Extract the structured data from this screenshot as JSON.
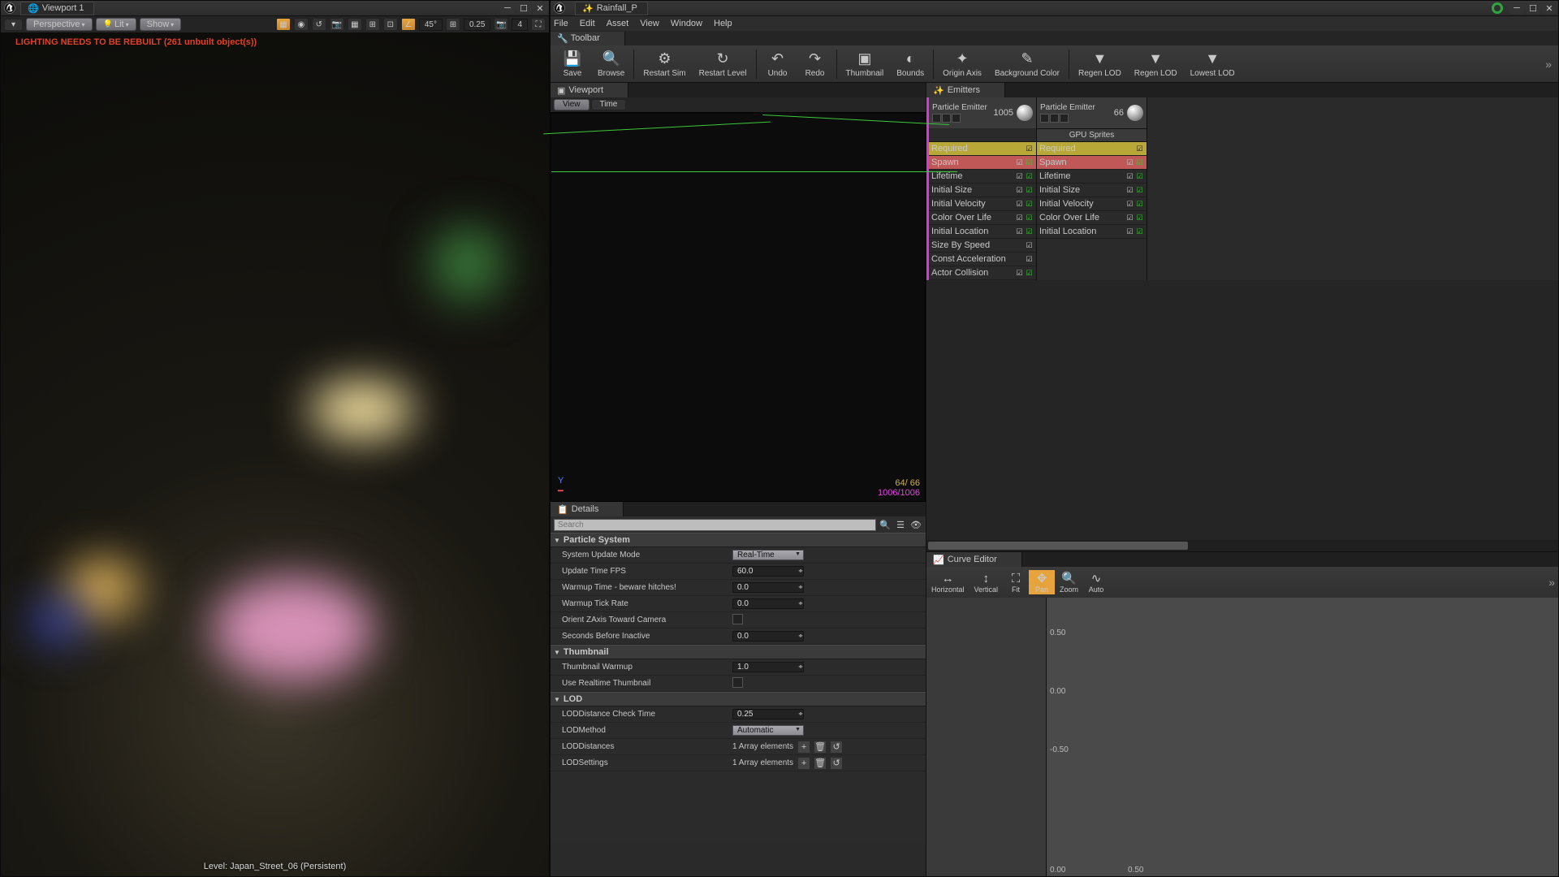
{
  "leftWindow": {
    "tabTitle": "Viewport 1",
    "viewportControls": {
      "perspective": "Perspective",
      "lit": "Lit",
      "show": "Show",
      "angleSnap": "45°",
      "gridSnap": "0.25",
      "scaleSnap": "4"
    },
    "warning": "LIGHTING NEEDS TO BE REBUILT (261 unbuilt object(s))",
    "levelLabel": "Level: Japan_Street_06 (Persistent)"
  },
  "rightWindow": {
    "tabTitle": "Rainfall_P",
    "menus": [
      "File",
      "Edit",
      "Asset",
      "View",
      "Window",
      "Help"
    ],
    "toolbarTab": "Toolbar",
    "toolbar": [
      {
        "label": "Save",
        "icon": "💾"
      },
      {
        "label": "Browse",
        "icon": "🔍"
      },
      {
        "label": "Restart Sim",
        "icon": "⚙"
      },
      {
        "label": "Restart Level",
        "icon": "↻"
      },
      {
        "label": "Undo",
        "icon": "↶"
      },
      {
        "label": "Redo",
        "icon": "↷"
      },
      {
        "label": "Thumbnail",
        "icon": "▣"
      },
      {
        "label": "Bounds",
        "icon": "◐"
      },
      {
        "label": "Origin Axis",
        "icon": "✦"
      },
      {
        "label": "Background Color",
        "icon": "✎"
      },
      {
        "label": "Regen LOD",
        "icon": "▼"
      },
      {
        "label": "Regen LOD",
        "icon": "▼"
      },
      {
        "label": "Lowest LOD",
        "icon": "▼"
      }
    ],
    "viewportTab": "Viewport",
    "viewBtn": "View",
    "timeBtn": "Time",
    "stats1": "64/ 66",
    "stats2": "1006/1006",
    "detailsTab": "Details",
    "searchPlaceholder": "Search",
    "sections": {
      "particleSystem": {
        "title": "Particle System",
        "rows": [
          {
            "label": "System Update Mode",
            "type": "dropdown",
            "value": "Real-Time"
          },
          {
            "label": "Update Time FPS",
            "type": "spin",
            "value": "60.0"
          },
          {
            "label": "Warmup Time - beware hitches!",
            "type": "spin",
            "value": "0.0"
          },
          {
            "label": "Warmup Tick Rate",
            "type": "spin",
            "value": "0.0"
          },
          {
            "label": "Orient ZAxis Toward Camera",
            "type": "check",
            "value": false
          },
          {
            "label": "Seconds Before Inactive",
            "type": "spin",
            "value": "0.0"
          }
        ]
      },
      "thumbnail": {
        "title": "Thumbnail",
        "rows": [
          {
            "label": "Thumbnail Warmup",
            "type": "spin",
            "value": "1.0"
          },
          {
            "label": "Use Realtime Thumbnail",
            "type": "check",
            "value": false
          }
        ]
      },
      "lod": {
        "title": "LOD",
        "rows": [
          {
            "label": "LODDistance Check Time",
            "type": "spin",
            "value": "0.25"
          },
          {
            "label": "LODMethod",
            "type": "dropdown",
            "value": "Automatic"
          },
          {
            "label": "LODDistances",
            "type": "array",
            "value": "1 Array elements"
          },
          {
            "label": "LODSettings",
            "type": "array",
            "value": "1 Array elements"
          }
        ]
      }
    },
    "emittersTab": "Emitters",
    "emitters": [
      {
        "name": "Particle Emitter",
        "count": "1005",
        "selected": true,
        "modules": [
          {
            "name": "Required",
            "cls": "required",
            "chk": 1
          },
          {
            "name": "Spawn",
            "cls": "spawn",
            "chk": 2
          },
          {
            "name": "Lifetime",
            "cls": "",
            "chk": 2
          },
          {
            "name": "Initial Size",
            "cls": "",
            "chk": 2
          },
          {
            "name": "Initial Velocity",
            "cls": "",
            "chk": 2
          },
          {
            "name": "Color Over Life",
            "cls": "",
            "chk": 2
          },
          {
            "name": "Initial Location",
            "cls": "",
            "chk": 2
          },
          {
            "name": "Size By Speed",
            "cls": "",
            "chk": 1
          },
          {
            "name": "Const Acceleration",
            "cls": "",
            "chk": 1
          },
          {
            "name": "Actor Collision",
            "cls": "",
            "chk": 2
          }
        ]
      },
      {
        "name": "Particle Emitter",
        "count": "66",
        "selected": false,
        "modules": [
          {
            "name": "Required",
            "cls": "required",
            "chk": 1
          },
          {
            "name": "Spawn",
            "cls": "spawn",
            "chk": 2
          },
          {
            "name": "Lifetime",
            "cls": "",
            "chk": 2
          },
          {
            "name": "Initial Size",
            "cls": "",
            "chk": 2
          },
          {
            "name": "Initial Velocity",
            "cls": "",
            "chk": 2
          },
          {
            "name": "Color Over Life",
            "cls": "",
            "chk": 2
          },
          {
            "name": "Initial Location",
            "cls": "",
            "chk": 2
          }
        ]
      }
    ],
    "gpuSprites": "GPU Sprites",
    "curveTab": "Curve Editor",
    "curveButtons": [
      {
        "label": "Horizontal",
        "icon": "↔"
      },
      {
        "label": "Vertical",
        "icon": "↕"
      },
      {
        "label": "Fit",
        "icon": "⛶"
      },
      {
        "label": "Pan",
        "icon": "✥",
        "active": true
      },
      {
        "label": "Zoom",
        "icon": "🔍"
      },
      {
        "label": "Auto",
        "icon": "∿"
      }
    ],
    "curveYLabels": [
      "0.50",
      "0.00",
      "-0.50"
    ],
    "curveXLabels": [
      "0.00",
      "0.50"
    ]
  }
}
